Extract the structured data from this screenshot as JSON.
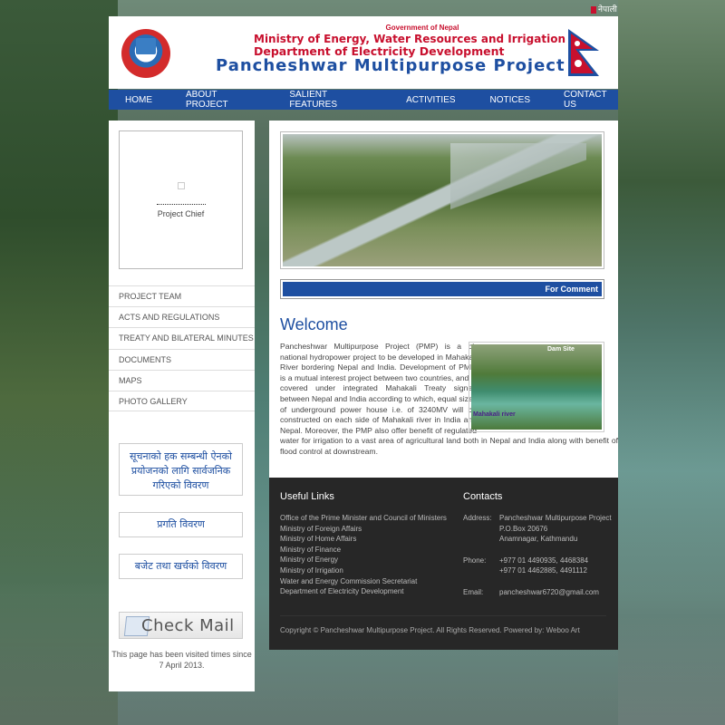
{
  "lang_switch": "नेपाली",
  "header": {
    "gov": "Government of Nepal",
    "ministry": "Ministry of Energy, Water Resources and Irrigation",
    "department": "Department of Electricity Development",
    "project": "Pancheshwar Multipurpose Project"
  },
  "nav": [
    "HOME",
    "ABOUT PROJECT",
    "SALIENT FEATURES",
    "ACTIVITIES",
    "NOTICES",
    "CONTACT US"
  ],
  "sidebar": {
    "chief_label": "Project Chief",
    "menu": [
      "PROJECT TEAM",
      "ACTS AND REGULATIONS",
      "TREATY AND BILATERAL MINUTES",
      "DOCUMENTS",
      "MAPS",
      "PHOTO GALLERY"
    ],
    "nep_info": "सूचनाको हक सम्बन्धी ऐनको प्रयोजनको लागि सार्वजनिक गरिएको विवरण",
    "nep_progress": "प्रगति विवरण",
    "nep_budget": "बजेट तथा खर्चको विवरण",
    "check_mail": "Check Mail",
    "visited": "This page has been visited times since 7 April 2013."
  },
  "main": {
    "ticker": "For Comment",
    "welcome": "Welcome",
    "img_label_dam": "Dam Site",
    "img_label_river": "Mahakali river",
    "body": "Pancheshwar Multipurpose Project (PMP) is a bi-national hydropower project to be developed in Mahakali River bordering Nepal and India. Development of PMP, is a mutual interest project between two countries, and is covered under integrated Mahakali Treaty signed between Nepal and India according to which, equal sizes of underground power house i.e. of 3240MV will be constructed on each side of Mahakali river in India and Nepal. Moreover, the PMP also offer benefit of regulated water for irrigation to a vast area of agricultural land both in Nepal and India along with benefit of flood control at downstream."
  },
  "footer": {
    "links_title": "Useful Links",
    "links": [
      "Office of the Prime Minister and Council of Ministers",
      "Ministry of Foreign Affairs",
      "Ministry of Home Affairs",
      "Ministry of Finance",
      "Ministry of Energy",
      "Ministry of Irrigation",
      "Water and Energy Commission Secretariat",
      "Department of Electricity Development"
    ],
    "contacts_title": "Contacts",
    "address_label": "Address:",
    "address_lines": [
      "Pancheshwar Multipurpose Project",
      "P.O.Box 20676",
      "Anamnagar, Kathmandu"
    ],
    "phone_label": "Phone:",
    "phone_lines": [
      "+977 01 4490935, 4468384",
      "+977 01 4462885, 4491112"
    ],
    "email_label": "Email:",
    "email": "pancheshwar6720@gmail.com",
    "copyright": "Copyright © Pancheshwar Multipurpose Project. All Rights Reserved. Powered by: Weboo Art"
  },
  "colors": {
    "primary": "#1e4fa1",
    "accent_red": "#c8102e",
    "footer_bg": "#272727"
  }
}
